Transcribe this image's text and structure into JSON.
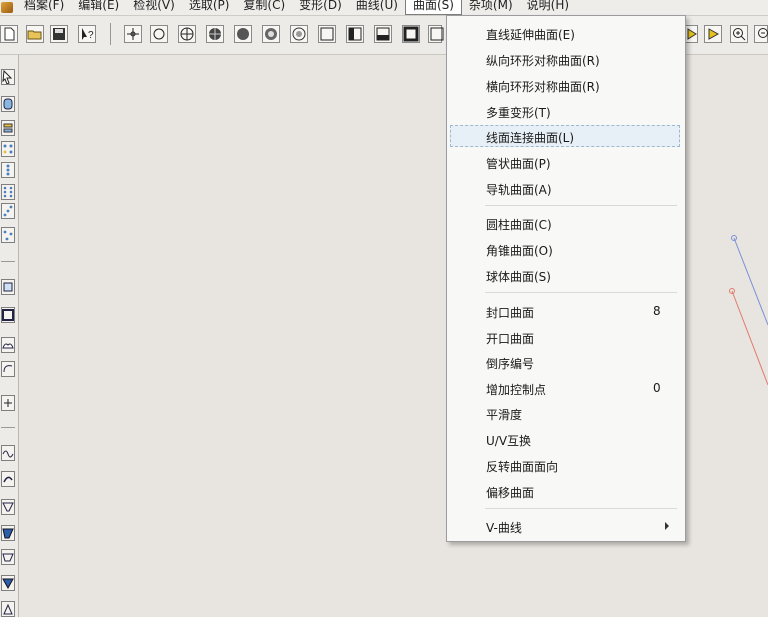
{
  "menubar": {
    "items": [
      {
        "label": "档案(F)"
      },
      {
        "label": "编辑(E)"
      },
      {
        "label": "检视(V)"
      },
      {
        "label": "选取(P)"
      },
      {
        "label": "复制(C)"
      },
      {
        "label": "变形(D)"
      },
      {
        "label": "曲线(U)"
      },
      {
        "label": "曲面(S)"
      },
      {
        "label": "杂项(M)"
      },
      {
        "label": "说明(H)"
      }
    ],
    "active_index": 7
  },
  "dropdown": {
    "items": [
      {
        "label": "直线延伸曲面(E)",
        "key": ""
      },
      {
        "label": "纵向环形对称曲面(R)",
        "key": ""
      },
      {
        "label": "横向环形对称曲面(R)",
        "key": ""
      },
      {
        "label": "多重变形(T)",
        "key": ""
      },
      {
        "label": "线面连接曲面(L)",
        "key": ""
      },
      {
        "label": "管状曲面(P)",
        "key": ""
      },
      {
        "label": "导轨曲面(A)",
        "key": ""
      },
      {
        "label": "圆柱曲面(C)",
        "key": ""
      },
      {
        "label": "角锥曲面(O)",
        "key": ""
      },
      {
        "label": "球体曲面(S)",
        "key": ""
      },
      {
        "label": "封口曲面",
        "key": "8"
      },
      {
        "label": "开口曲面",
        "key": ""
      },
      {
        "label": "倒序编号",
        "key": ""
      },
      {
        "label": "增加控制点",
        "key": "0"
      },
      {
        "label": "平滑度",
        "key": ""
      },
      {
        "label": "U/V互换",
        "key": ""
      },
      {
        "label": "反转曲面面向",
        "key": ""
      },
      {
        "label": "偏移曲面",
        "key": ""
      },
      {
        "label": "V-曲线",
        "key": ""
      }
    ],
    "highlighted_index": 4
  },
  "colors": {
    "accent_line_blue": "#7b8fd6",
    "accent_line_red": "#e07a6e"
  }
}
